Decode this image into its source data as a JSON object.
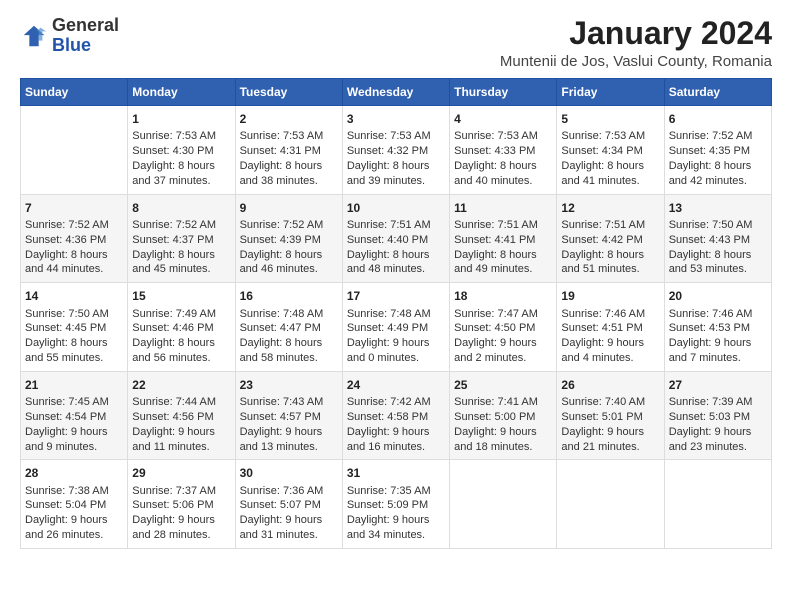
{
  "logo": {
    "general": "General",
    "blue": "Blue"
  },
  "header": {
    "title": "January 2024",
    "subtitle": "Muntenii de Jos, Vaslui County, Romania"
  },
  "weekdays": [
    "Sunday",
    "Monday",
    "Tuesday",
    "Wednesday",
    "Thursday",
    "Friday",
    "Saturday"
  ],
  "weeks": [
    [
      {
        "day": "",
        "text": ""
      },
      {
        "day": "1",
        "text": "Sunrise: 7:53 AM\nSunset: 4:30 PM\nDaylight: 8 hours\nand 37 minutes."
      },
      {
        "day": "2",
        "text": "Sunrise: 7:53 AM\nSunset: 4:31 PM\nDaylight: 8 hours\nand 38 minutes."
      },
      {
        "day": "3",
        "text": "Sunrise: 7:53 AM\nSunset: 4:32 PM\nDaylight: 8 hours\nand 39 minutes."
      },
      {
        "day": "4",
        "text": "Sunrise: 7:53 AM\nSunset: 4:33 PM\nDaylight: 8 hours\nand 40 minutes."
      },
      {
        "day": "5",
        "text": "Sunrise: 7:53 AM\nSunset: 4:34 PM\nDaylight: 8 hours\nand 41 minutes."
      },
      {
        "day": "6",
        "text": "Sunrise: 7:52 AM\nSunset: 4:35 PM\nDaylight: 8 hours\nand 42 minutes."
      }
    ],
    [
      {
        "day": "7",
        "text": "Sunrise: 7:52 AM\nSunset: 4:36 PM\nDaylight: 8 hours\nand 44 minutes."
      },
      {
        "day": "8",
        "text": "Sunrise: 7:52 AM\nSunset: 4:37 PM\nDaylight: 8 hours\nand 45 minutes."
      },
      {
        "day": "9",
        "text": "Sunrise: 7:52 AM\nSunset: 4:39 PM\nDaylight: 8 hours\nand 46 minutes."
      },
      {
        "day": "10",
        "text": "Sunrise: 7:51 AM\nSunset: 4:40 PM\nDaylight: 8 hours\nand 48 minutes."
      },
      {
        "day": "11",
        "text": "Sunrise: 7:51 AM\nSunset: 4:41 PM\nDaylight: 8 hours\nand 49 minutes."
      },
      {
        "day": "12",
        "text": "Sunrise: 7:51 AM\nSunset: 4:42 PM\nDaylight: 8 hours\nand 51 minutes."
      },
      {
        "day": "13",
        "text": "Sunrise: 7:50 AM\nSunset: 4:43 PM\nDaylight: 8 hours\nand 53 minutes."
      }
    ],
    [
      {
        "day": "14",
        "text": "Sunrise: 7:50 AM\nSunset: 4:45 PM\nDaylight: 8 hours\nand 55 minutes."
      },
      {
        "day": "15",
        "text": "Sunrise: 7:49 AM\nSunset: 4:46 PM\nDaylight: 8 hours\nand 56 minutes."
      },
      {
        "day": "16",
        "text": "Sunrise: 7:48 AM\nSunset: 4:47 PM\nDaylight: 8 hours\nand 58 minutes."
      },
      {
        "day": "17",
        "text": "Sunrise: 7:48 AM\nSunset: 4:49 PM\nDaylight: 9 hours\nand 0 minutes."
      },
      {
        "day": "18",
        "text": "Sunrise: 7:47 AM\nSunset: 4:50 PM\nDaylight: 9 hours\nand 2 minutes."
      },
      {
        "day": "19",
        "text": "Sunrise: 7:46 AM\nSunset: 4:51 PM\nDaylight: 9 hours\nand 4 minutes."
      },
      {
        "day": "20",
        "text": "Sunrise: 7:46 AM\nSunset: 4:53 PM\nDaylight: 9 hours\nand 7 minutes."
      }
    ],
    [
      {
        "day": "21",
        "text": "Sunrise: 7:45 AM\nSunset: 4:54 PM\nDaylight: 9 hours\nand 9 minutes."
      },
      {
        "day": "22",
        "text": "Sunrise: 7:44 AM\nSunset: 4:56 PM\nDaylight: 9 hours\nand 11 minutes."
      },
      {
        "day": "23",
        "text": "Sunrise: 7:43 AM\nSunset: 4:57 PM\nDaylight: 9 hours\nand 13 minutes."
      },
      {
        "day": "24",
        "text": "Sunrise: 7:42 AM\nSunset: 4:58 PM\nDaylight: 9 hours\nand 16 minutes."
      },
      {
        "day": "25",
        "text": "Sunrise: 7:41 AM\nSunset: 5:00 PM\nDaylight: 9 hours\nand 18 minutes."
      },
      {
        "day": "26",
        "text": "Sunrise: 7:40 AM\nSunset: 5:01 PM\nDaylight: 9 hours\nand 21 minutes."
      },
      {
        "day": "27",
        "text": "Sunrise: 7:39 AM\nSunset: 5:03 PM\nDaylight: 9 hours\nand 23 minutes."
      }
    ],
    [
      {
        "day": "28",
        "text": "Sunrise: 7:38 AM\nSunset: 5:04 PM\nDaylight: 9 hours\nand 26 minutes."
      },
      {
        "day": "29",
        "text": "Sunrise: 7:37 AM\nSunset: 5:06 PM\nDaylight: 9 hours\nand 28 minutes."
      },
      {
        "day": "30",
        "text": "Sunrise: 7:36 AM\nSunset: 5:07 PM\nDaylight: 9 hours\nand 31 minutes."
      },
      {
        "day": "31",
        "text": "Sunrise: 7:35 AM\nSunset: 5:09 PM\nDaylight: 9 hours\nand 34 minutes."
      },
      {
        "day": "",
        "text": ""
      },
      {
        "day": "",
        "text": ""
      },
      {
        "day": "",
        "text": ""
      }
    ]
  ]
}
